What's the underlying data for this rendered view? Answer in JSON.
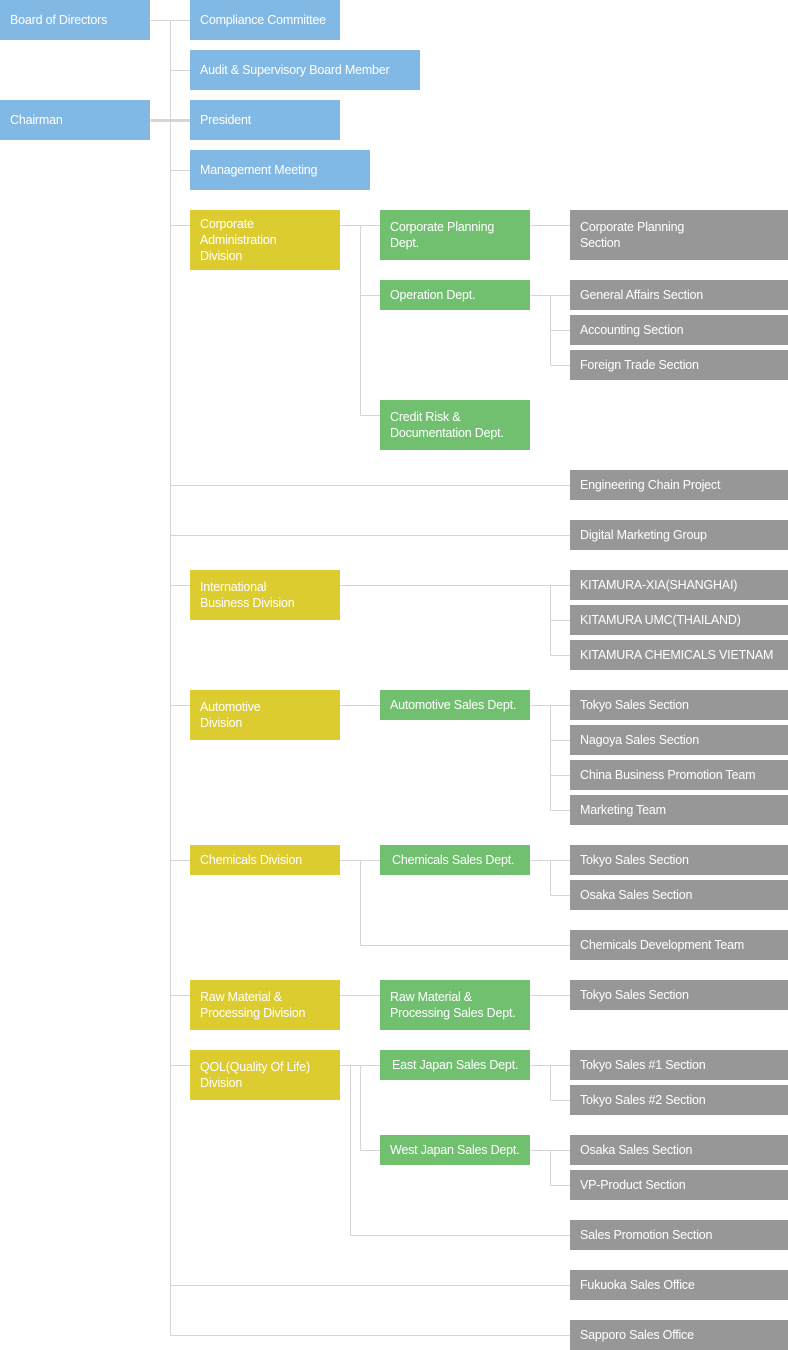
{
  "colors": {
    "governance": "#82b8e4",
    "division": "#dccc30",
    "department": "#70c070",
    "section": "#979797",
    "connector": "#d5d5d5"
  },
  "governance": {
    "board": "Board of Directors",
    "chairman": "Chairman",
    "compliance": "Compliance Committee",
    "audit": "Audit & Supervisory Board Member",
    "president": "President",
    "management": "Management Meeting"
  },
  "divisions": {
    "corporate_admin": "Corporate\nAdministration\nDivision",
    "international": "International\nBusiness Division",
    "automotive": "Automotive\nDivision",
    "chemicals": "Chemicals Division",
    "raw_material": "Raw Material &\nProcessing Division",
    "qol": "QOL(Quality Of Life)\nDivision"
  },
  "departments": {
    "corp_planning": "Corporate Planning\nDept.",
    "operation": "Operation Dept.",
    "credit_risk": "Credit Risk &\nDocumentation Dept.",
    "auto_sales": "Automotive Sales Dept.",
    "chem_sales": "Chemicals Sales Dept.",
    "raw_sales": "Raw Material &\nProcessing Sales Dept.",
    "east_japan": "East Japan Sales Dept.",
    "west_japan": "West Japan Sales Dept."
  },
  "sections": {
    "corp_planning_sec": "Corporate Planning\nSection",
    "general_affairs": "General Affairs Section",
    "accounting": "Accounting Section",
    "foreign_trade": "Foreign Trade Section",
    "engineering_chain": "Engineering Chain Project",
    "digital_marketing": "Digital Marketing Group",
    "xia": "KITAMURA-XIA(SHANGHAI)",
    "umc": "KITAMURA UMC(THAILAND)",
    "vietnam": "KITAMURA CHEMICALS VIETNAM",
    "auto_tokyo": "Tokyo Sales Section",
    "auto_nagoya": "Nagoya Sales Section",
    "auto_china": "China Business Promotion Team",
    "auto_marketing": "Marketing Team",
    "chem_tokyo": "Tokyo Sales Section",
    "chem_osaka": "Osaka Sales Section",
    "chem_dev": "Chemicals Development Team",
    "raw_tokyo": "Tokyo Sales Section",
    "tokyo1": "Tokyo Sales #1 Section",
    "tokyo2": "Tokyo Sales #2 Section",
    "qol_osaka": "Osaka Sales Section",
    "vp_product": "VP-Product Section",
    "sales_promo": "Sales Promotion Section",
    "fukuoka": "Fukuoka Sales Office",
    "sapporo": "Sapporo Sales Office"
  }
}
